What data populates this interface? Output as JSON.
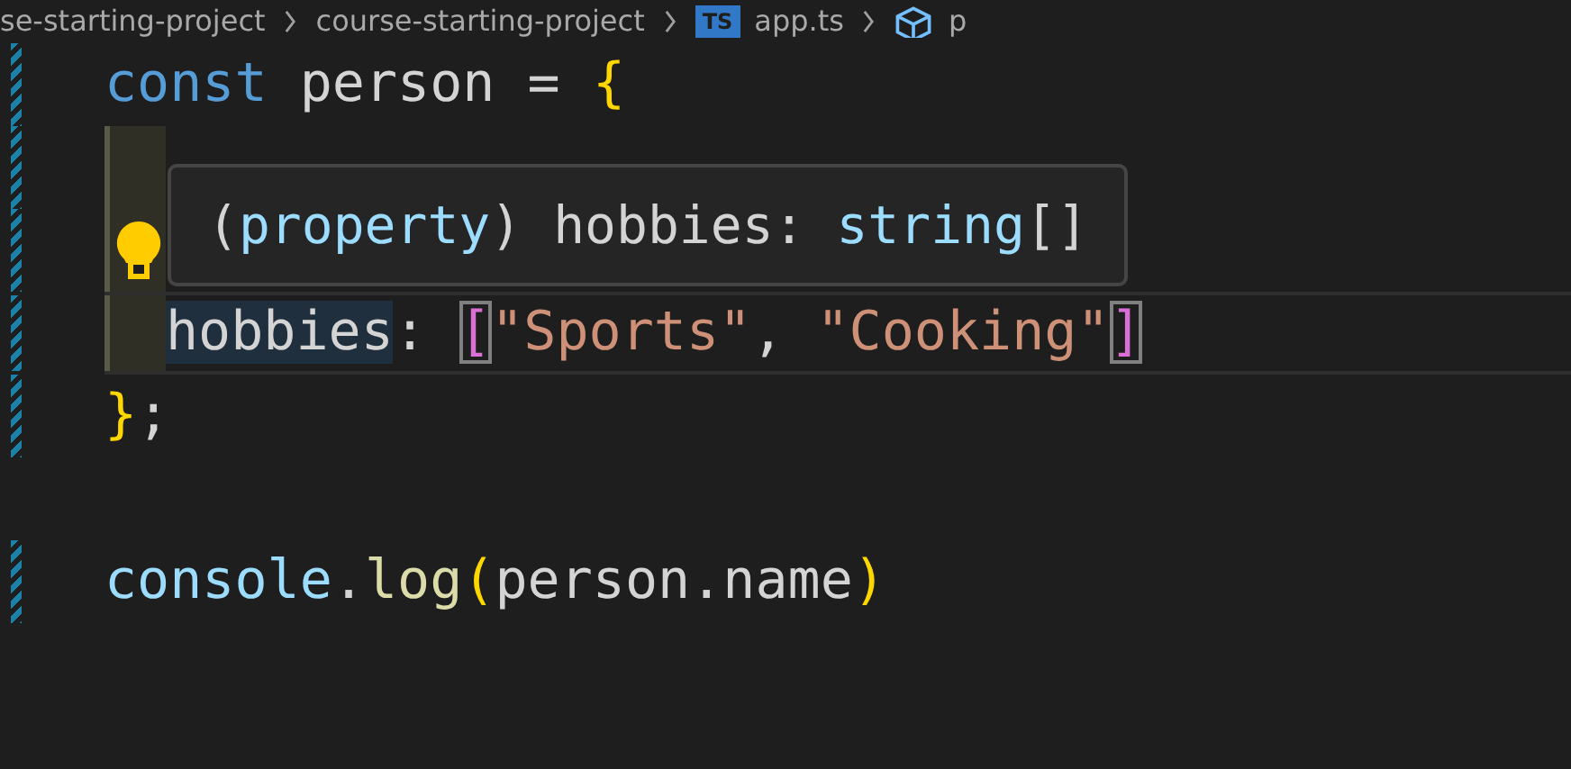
{
  "breadcrumb": [
    {
      "kind": "folder",
      "label": "se-starting-project"
    },
    {
      "kind": "folder",
      "label": "course-starting-project"
    },
    {
      "kind": "file",
      "label": "app.ts",
      "badge": "TS"
    },
    {
      "kind": "symbol",
      "label": "p"
    }
  ],
  "lines": [
    {
      "modified": true,
      "indented": false,
      "current": false,
      "lightbulb": false,
      "tokens": [
        {
          "text": "const",
          "kind": "keyword"
        },
        {
          "text": " person = ",
          "kind": "plain"
        },
        {
          "text": "{",
          "kind": "brace"
        }
      ]
    },
    {
      "modified": true,
      "indented": true,
      "current": false,
      "lightbulb": false
    },
    {
      "modified": true,
      "indented": true,
      "current": false,
      "lightbulb": true
    },
    {
      "modified": true,
      "indented": true,
      "current": true,
      "lightbulb": false,
      "tokens": [
        {
          "text": "hobbies",
          "kind": "plain",
          "highlighted": true
        },
        {
          "text": ": ",
          "kind": "plain"
        },
        {
          "text": "[",
          "kind": "bracket",
          "matched": true
        },
        {
          "text": "\"Sports\"",
          "kind": "string"
        },
        {
          "text": ", ",
          "kind": "plain"
        },
        {
          "text": "\"Cooking\"",
          "kind": "string"
        },
        {
          "text": "]",
          "kind": "bracket",
          "matched": true
        }
      ]
    },
    {
      "modified": true,
      "indented": false,
      "current": false,
      "lightbulb": false,
      "tokens": [
        {
          "text": "}",
          "kind": "brace"
        },
        {
          "text": ";",
          "kind": "plain"
        }
      ]
    },
    {
      "modified": false,
      "indented": false,
      "current": false,
      "lightbulb": false
    },
    {
      "modified": true,
      "indented": false,
      "current": false,
      "lightbulb": false,
      "tokens": [
        {
          "text": "console",
          "kind": "variable"
        },
        {
          "text": ".",
          "kind": "plain"
        },
        {
          "text": "log",
          "kind": "function"
        },
        {
          "text": "(",
          "kind": "brace"
        },
        {
          "text": "person.name",
          "kind": "plain"
        },
        {
          "text": ")",
          "kind": "brace"
        }
      ]
    }
  ],
  "hover": {
    "tokens": [
      {
        "text": "(",
        "kind": "plain"
      },
      {
        "text": "property",
        "kind": "variable"
      },
      {
        "text": ") hobbies: ",
        "kind": "plain"
      },
      {
        "text": "string",
        "kind": "variable"
      },
      {
        "text": "[]",
        "kind": "plain"
      }
    ]
  }
}
